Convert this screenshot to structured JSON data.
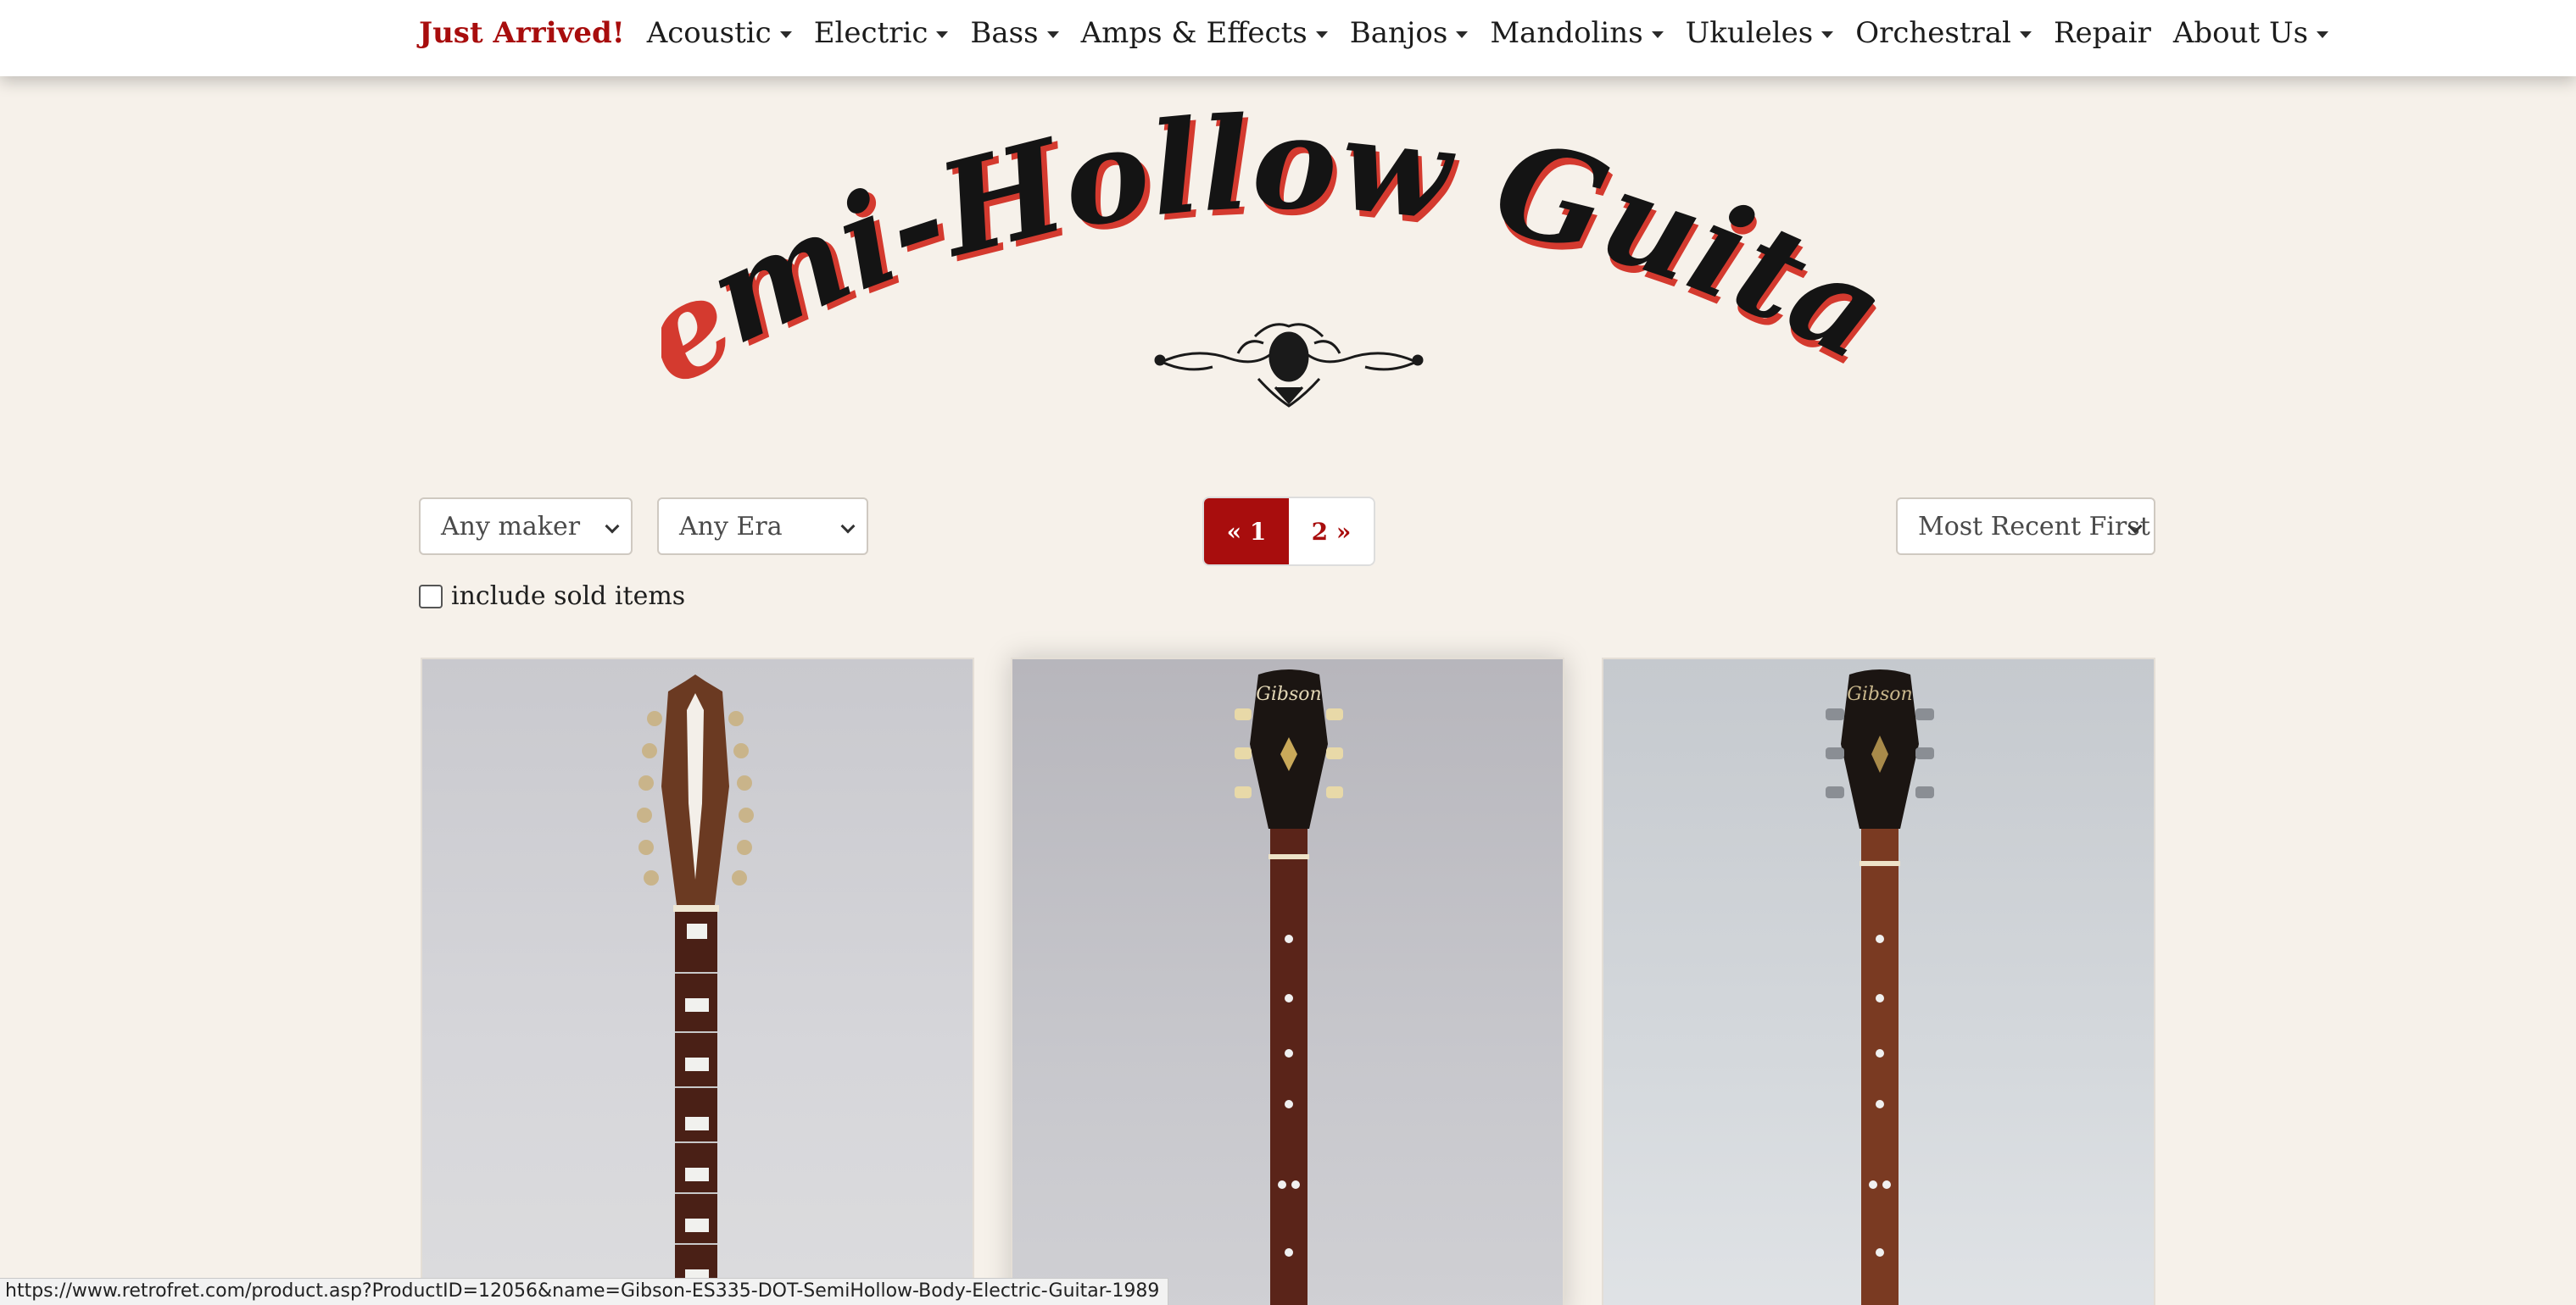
{
  "nav": {
    "items": [
      {
        "label": "Just Arrived!",
        "dropdown": false,
        "highlight": true
      },
      {
        "label": "Acoustic",
        "dropdown": true
      },
      {
        "label": "Electric",
        "dropdown": true
      },
      {
        "label": "Bass",
        "dropdown": true
      },
      {
        "label": "Amps & Effects",
        "dropdown": true
      },
      {
        "label": "Banjos",
        "dropdown": true
      },
      {
        "label": "Mandolins",
        "dropdown": true
      },
      {
        "label": "Ukuleles",
        "dropdown": true
      },
      {
        "label": "Orchestral",
        "dropdown": true
      },
      {
        "label": "Repair",
        "dropdown": false
      },
      {
        "label": "About Us",
        "dropdown": true
      }
    ]
  },
  "title": {
    "text": "Semi-Hollow Guitars"
  },
  "filters": {
    "maker": "Any maker",
    "era": "Any Era",
    "sort": "Most Recent First",
    "include_sold_label": "include sold items",
    "include_sold_checked": false
  },
  "pagination": {
    "current": "« 1",
    "next": "2 »"
  },
  "products": [
    {
      "image": "12-string semi-hollow guitar headstock and neck"
    },
    {
      "image": "Gibson headstock and dot-inlay neck"
    },
    {
      "image": "Gibson headstock and dot-inlay neck"
    }
  ],
  "status_bar": {
    "url": "https://www.retrofret.com/product.asp?ProductID=12056&name=Gibson-ES335-DOT-SemiHollow-Body-Electric-Guitar-1989"
  },
  "colors": {
    "accent": "#a80d0d",
    "background": "#f6f1ea"
  }
}
